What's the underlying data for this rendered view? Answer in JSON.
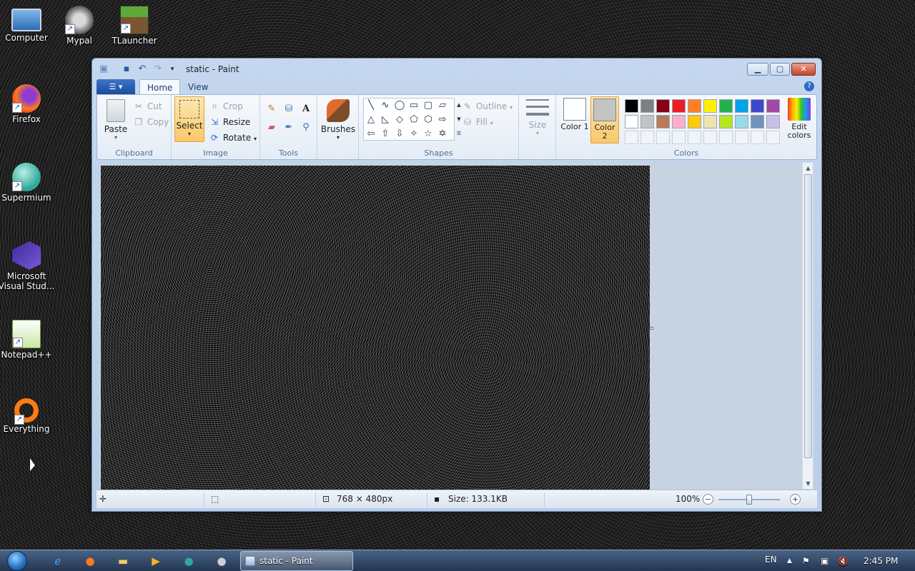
{
  "desktop": {
    "icons": [
      {
        "label": "Computer"
      },
      {
        "label": "Mypal"
      },
      {
        "label": "TLauncher"
      },
      {
        "label": "Firefox"
      },
      {
        "label": "Supermium"
      },
      {
        "label": "Microsoft Visual Stud..."
      },
      {
        "label": "Notepad++"
      },
      {
        "label": "Everything"
      }
    ]
  },
  "window": {
    "title": "static - Paint",
    "qat": {
      "save_icon": "save-icon",
      "undo_icon": "undo-icon",
      "redo_icon": "redo-icon",
      "customize_icon": "dropdown-icon"
    },
    "controls": {
      "minimize": "▁",
      "maximize": "▢",
      "close": "✕"
    }
  },
  "tabs": {
    "menu": "☰ ▾",
    "home": "Home",
    "view": "View",
    "help": "?"
  },
  "ribbon": {
    "clipboard": {
      "label": "Clipboard",
      "paste": "Paste",
      "cut": "Cut",
      "copy": "Copy"
    },
    "image": {
      "label": "Image",
      "select": "Select",
      "crop": "Crop",
      "resize": "Resize",
      "rotate": "Rotate"
    },
    "tools": {
      "label": "Tools"
    },
    "brushes": {
      "label": "Brushes"
    },
    "shapes": {
      "label": "Shapes",
      "outline": "Outline",
      "fill": "Fill"
    },
    "size": {
      "label": "Size"
    },
    "colors": {
      "label": "Colors",
      "color1": "Color 1",
      "color2": "Color 2",
      "edit": "Edit colors",
      "color1_value": "#ffffff",
      "color2_value": "#c3c3c3",
      "palette_row1": [
        "#000000",
        "#7f7f7f",
        "#880015",
        "#ed1c24",
        "#ff7f27",
        "#fff200",
        "#22b14c",
        "#00a2e8",
        "#3f48cc",
        "#a349a4"
      ],
      "palette_row2": [
        "#ffffff",
        "#c3c3c3",
        "#b97a57",
        "#ffaec9",
        "#ffc90e",
        "#efe4b0",
        "#b5e61d",
        "#99d9ea",
        "#7092be",
        "#c8bfe7"
      ]
    }
  },
  "status": {
    "dimensions": "768 × 480px",
    "size": "Size: 133.1KB",
    "zoom": "100%",
    "zoom_out": "−",
    "zoom_in": "+"
  },
  "taskbar": {
    "active_task": "static - Paint",
    "language": "EN",
    "time": "2:45 PM"
  }
}
